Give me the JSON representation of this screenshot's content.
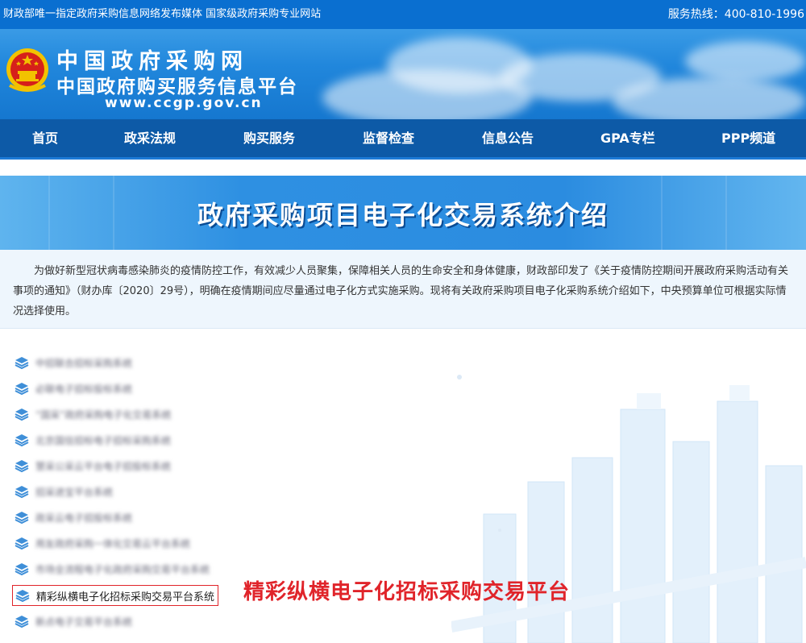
{
  "topbar": {
    "left_text": "财政部唯一指定政府采购信息网络发布媒体 国家级政府采购专业网站",
    "right_text": "服务热线：400-810-1996"
  },
  "header": {
    "title": "中国政府采购网",
    "subtitle": "中国政府购买服务信息平台",
    "url": "www.ccgp.gov.cn"
  },
  "nav": {
    "items": [
      "首页",
      "政采法规",
      "购买服务",
      "监督检查",
      "信息公告",
      "GPA专栏",
      "PPP频道"
    ]
  },
  "banner": {
    "title": "政府采购项目电子化交易系统介绍"
  },
  "intro": {
    "text": "为做好新型冠状病毒感染肺炎的疫情防控工作，有效减少人员聚集，保障相关人员的生命安全和身体健康，财政部印发了《关于疫情防控期间开展政府采购活动有关事项的通知》（财办库〔2020〕29号），明确在疫情期间应尽量通过电子化方式实施采购。现将有关政府采购项目电子化采购系统介绍如下，中央预算单位可根据实际情况选择使用。"
  },
  "list": {
    "items": [
      {
        "label": "中招联合招标采购系统",
        "blurred": true
      },
      {
        "label": "必联电子招标投标系统",
        "blurred": true
      },
      {
        "label": "“国采”政府采购电子化交易系统",
        "blurred": true
      },
      {
        "label": "北京国信招标电子招标采购系统",
        "blurred": true
      },
      {
        "label": "慧采公采云平台电子招投标系统",
        "blurred": true
      },
      {
        "label": "招采进宝平台系统",
        "blurred": true
      },
      {
        "label": "政采云电子招投标系统",
        "blurred": true
      },
      {
        "label": "用友政府采购一体化交易云平台系统",
        "blurred": true
      },
      {
        "label": "市场全流程电子化政府采购交易平台系统",
        "blurred": true
      },
      {
        "label": "精彩纵横电子化招标采购交易平台系统",
        "blurred": false
      },
      {
        "label": "新点电子交易平台系统",
        "blurred": true
      }
    ]
  },
  "annotation": {
    "text": "精彩纵横电子化招标采购交易平台"
  },
  "colors": {
    "nav_bg": "#0d5aa7",
    "topbar_bg": "#0a6fd0",
    "highlight_red": "#e0242a"
  }
}
